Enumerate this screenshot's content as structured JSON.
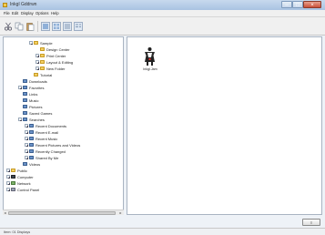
{
  "window": {
    "title": "Inkgl Gddrwn"
  },
  "menu": [
    "File",
    "Edit",
    "Display",
    "Options",
    "Help"
  ],
  "toolbar": {
    "icons": [
      "cut-icon",
      "copy-icon",
      "paste-icon",
      "large-icons-view",
      "small-icons-view",
      "list-view",
      "details-view"
    ]
  },
  "tree": {
    "items": [
      {
        "label": "Sample",
        "expander": "minus",
        "icon": "folder"
      },
      {
        "label": "Design Center",
        "expander": "",
        "icon": "folder"
      },
      {
        "label": "Print Center",
        "expander": "plus",
        "icon": "folder"
      },
      {
        "label": "Layout & Editing",
        "expander": "plus",
        "icon": "folder"
      },
      {
        "label": "New Folder",
        "expander": "plus",
        "icon": "folder"
      },
      {
        "label": "Tutorial",
        "expander": "",
        "icon": "folder"
      },
      {
        "label": "Downloads",
        "expander": "",
        "icon": "blue"
      },
      {
        "label": "Favorites",
        "expander": "plus",
        "icon": "blue"
      },
      {
        "label": "Links",
        "expander": "",
        "icon": "blue"
      },
      {
        "label": "Music",
        "expander": "",
        "icon": "blue"
      },
      {
        "label": "Pictures",
        "expander": "",
        "icon": "blue"
      },
      {
        "label": "Saved Games",
        "expander": "",
        "icon": "blue"
      },
      {
        "label": "Searches",
        "expander": "minus",
        "icon": "blue"
      },
      {
        "label": "Recent Documents",
        "expander": "plus",
        "icon": "blue"
      },
      {
        "label": "Recent E-mail",
        "expander": "plus",
        "icon": "blue"
      },
      {
        "label": "Recent Music",
        "expander": "plus",
        "icon": "blue"
      },
      {
        "label": "Recent Pictures and Videos",
        "expander": "plus",
        "icon": "blue"
      },
      {
        "label": "Recently Changed",
        "expander": "plus",
        "icon": "blue"
      },
      {
        "label": "Shared By Me",
        "expander": "plus",
        "icon": "blue"
      },
      {
        "label": "Videos",
        "expander": "",
        "icon": "blue"
      },
      {
        "label": "Public",
        "expander": "plus",
        "icon": "folder"
      },
      {
        "label": "Computer",
        "expander": "plus",
        "icon": "dark"
      },
      {
        "label": "Network",
        "expander": "plus",
        "icon": "green"
      },
      {
        "label": "Control Panel",
        "expander": "plus",
        "icon": "gray"
      }
    ]
  },
  "content": {
    "items": [
      {
        "name": "Inkgl.Jam",
        "icon": "caddy-figure-icon"
      }
    ]
  },
  "minibutton": "≡",
  "status": {
    "text": "Item: 01 Displays"
  },
  "colors": {
    "titlebar": "#a9c3e2",
    "pane_border": "#a9b4c2",
    "folder": "#f3cf62"
  }
}
